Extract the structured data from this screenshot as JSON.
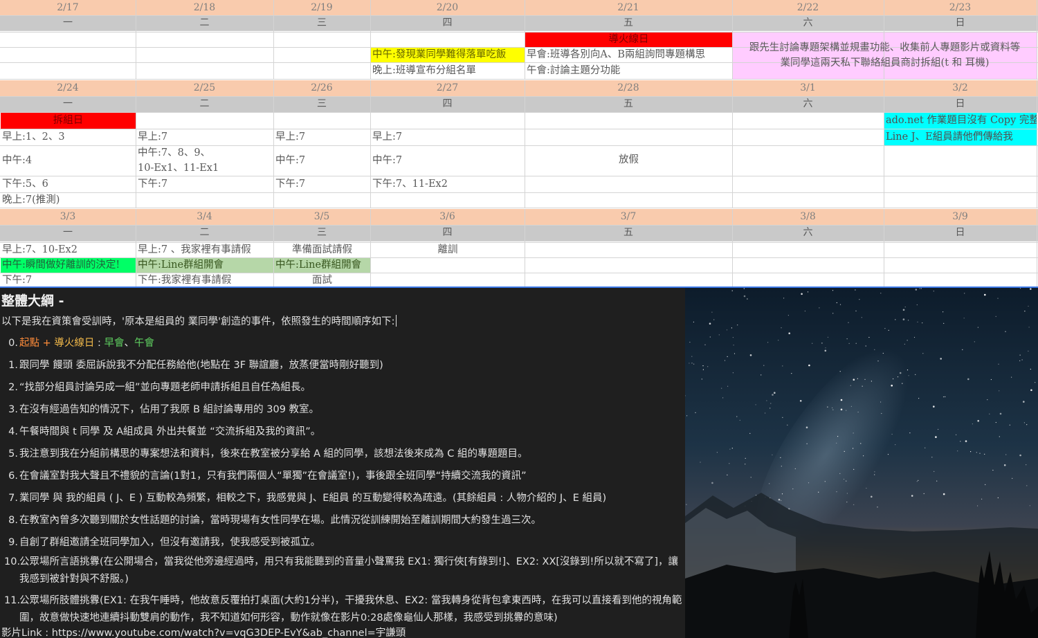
{
  "calendar": {
    "weeks": [
      {
        "dates": [
          "2/17",
          "2/18",
          "2/19",
          "2/20",
          "2/21",
          "2/22",
          "2/23"
        ],
        "weekdays": [
          "一",
          "二",
          "三",
          "四",
          "五",
          "六",
          "日"
        ],
        "cells": [
          {
            "text": "導火線日",
            "col": 4,
            "row": 0,
            "fill": "#ff0000",
            "color": "#7f0000",
            "align": "center"
          },
          {
            "text": "中午:發現業同學難得落單吃飯",
            "col": 3,
            "row": 1,
            "fill": "#ffff00",
            "color": "#666600"
          },
          {
            "text": "晚上:班導宣布分組名單",
            "col": 3,
            "row": 2
          },
          {
            "text": "早會:班導各別向A、B兩組詢問專題構思",
            "col": 4,
            "row": 1
          },
          {
            "text": "午會:討論主題分功能",
            "col": 4,
            "row": 2
          },
          {
            "text": "跟先生討論專題架構並規畫功能、收集前人專題影片或資料等",
            "col": 5,
            "row": 1,
            "span": 2,
            "align": "center"
          },
          {
            "text": "業同學這兩天私下聯絡組員商討拆組(t 和 耳機)",
            "col": 5,
            "row": 2,
            "span": 2,
            "align": "center"
          }
        ]
      },
      {
        "dates": [
          "2/24",
          "2/25",
          "2/26",
          "2/27",
          "2/28",
          "3/1",
          "3/2"
        ],
        "weekdays": [
          "一",
          "二",
          "三",
          "四",
          "五",
          "六",
          "日"
        ],
        "cells": [
          {
            "text": "拆組日",
            "col": 0,
            "row": 0,
            "fill": "#ff0000",
            "color": "#7f0000",
            "align": "center"
          },
          {
            "text": "早上:1、2、3",
            "col": 0,
            "row": 1
          },
          {
            "text": "中午:4",
            "col": 0,
            "row": 2
          },
          {
            "text": "下午:5、6",
            "col": 0,
            "row": 3
          },
          {
            "text": "晚上:7(推測)",
            "col": 0,
            "row": 4
          },
          {
            "text": "早上:7",
            "col": 1,
            "row": 1
          },
          {
            "text": "中午:7、8、9、",
            "col": 1,
            "row": 2
          },
          {
            "text": "10-Ex1、11-Ex1",
            "col": 1,
            "row": 2.9
          },
          {
            "text": "下午:7",
            "col": 1,
            "row": 3
          },
          {
            "text": "早上:7",
            "col": 2,
            "row": 1
          },
          {
            "text": "中午:7",
            "col": 2,
            "row": 2
          },
          {
            "text": "下午:7",
            "col": 2,
            "row": 3
          },
          {
            "text": "早上:7",
            "col": 3,
            "row": 1
          },
          {
            "text": "中午:7",
            "col": 3,
            "row": 2
          },
          {
            "text": "下午:7、11-Ex2",
            "col": 3,
            "row": 3
          },
          {
            "text": "放假",
            "col": 4,
            "row": 2,
            "align": "center"
          },
          {
            "text": "ado.net 作業題目沒有 Copy 完整",
            "col": 6,
            "row": 0,
            "fill": "#00ffff",
            "color": "#505050"
          },
          {
            "text": "Line J、E組員請他們傳給我",
            "col": 6,
            "row": 1,
            "fill": "#00ffff",
            "color": "#505050"
          }
        ]
      },
      {
        "dates": [
          "3/3",
          "3/4",
          "3/5",
          "3/6",
          "3/7",
          "3/8",
          "3/9"
        ],
        "weekdays": [
          "一",
          "二",
          "三",
          "四",
          "五",
          "六",
          "日"
        ],
        "cells": [
          {
            "text": "早上:7、10-Ex2",
            "col": 0,
            "row": 0
          },
          {
            "text": "中午:瞬間做好離訓的決定!",
            "col": 0,
            "row": 1,
            "fill": "#00ff66",
            "color": "#1f5f3a"
          },
          {
            "text": "下午:7",
            "col": 0,
            "row": 2
          },
          {
            "text": "早上:7 、我家裡有事請假",
            "col": 1,
            "row": 0
          },
          {
            "text": "中午:Line群組開會",
            "col": 1,
            "row": 1,
            "fill": "#b6d7a8",
            "color": "#38571f"
          },
          {
            "text": "下午:我家裡有事請假",
            "col": 1,
            "row": 2
          },
          {
            "text": "準備面試請假",
            "col": 2,
            "row": 0,
            "align": "center"
          },
          {
            "text": "中午:Line群組開會",
            "col": 2,
            "row": 1,
            "fill": "#b6d7a8",
            "color": "#38571f"
          },
          {
            "text": "面試",
            "col": 2,
            "row": 2,
            "align": "center"
          },
          {
            "text": "離訓",
            "col": 3,
            "row": 0,
            "align": "center"
          }
        ]
      }
    ]
  },
  "notes": {
    "title": "整體大綱 -",
    "intro": "以下是我在資策會受訓時，'原本是組員的 業同學'創造的事件，依照發生的時間順序如下:",
    "item0": {
      "num": "0.",
      "parts": [
        {
          "text": "起點",
          "color": "#ff8c3a"
        },
        {
          "text": " + ",
          "color": "#ff8c3a"
        },
        {
          "text": "導火線日",
          "color": "#f2b94a"
        },
        {
          "text": " : ",
          "color": "#e0e0e0"
        },
        {
          "text": "早會",
          "color": "#5fcf60"
        },
        {
          "text": "、",
          "color": "#e0e0e0"
        },
        {
          "text": "午會",
          "color": "#5fcf60"
        }
      ]
    },
    "items": [
      {
        "num": "1.",
        "text": "跟同學 饅頭 委屈訴說我不分配任務給他(地點在 3F 聯誼廳，放蒸便當時剛好聽到)"
      },
      {
        "num": "2.",
        "text": "“找部分組員討論另成一組”並向專題老師申請拆組且自任為組長。"
      },
      {
        "num": "3.",
        "text": "在沒有經過告知的情況下，佔用了我原 B 組討論專用的 309 教室。"
      },
      {
        "num": "4.",
        "text": "午餐時間與 t 同學 及 A組成員 外出共餐並 “交流拆組及我的資訊”。"
      },
      {
        "num": "5.",
        "text": "我注意到我在分組前構思的專案想法和資料，後來在教室被分享給 A 組的同學，該想法後來成為 C 組的專題題目。"
      },
      {
        "num": "6.",
        "text": "在會議室對我大聲且不禮貌的言論(1對1，只有我們兩個人“單獨”在會議室!)，事後跟全班同學“持續交流我的資訊”"
      },
      {
        "num": "7.",
        "text": "業同學 與 我的組員 ( J、E ) 互動較為頻繁，相較之下，我感覺與 J、E組員 的互動變得較為疏遠。(其餘組員 : 人物介紹的 J、E 組員)"
      },
      {
        "num": "8.",
        "text": "在教室內曾多次聽到關於女性話題的討論，當時現場有女性同學在場。此情況從訓練開始至離訓期間大約發生過三次。"
      },
      {
        "num": "9.",
        "text": "自創了群組邀請全班同學加入，但沒有邀請我，使我感受到被孤立。"
      },
      {
        "num": "10.",
        "text": "公眾場所言語挑釁(在公開場合，當我從他旁邊經過時，用只有我能聽到的音量小聲罵我 EX1: 獨行俠[有錄到!]、EX2: XX[沒錄到!所以就不寫了]，讓我感到被針對與不舒服。)"
      },
      {
        "num": "11.",
        "text": "公眾場所肢體挑釁(EX1: 在我午睡時，他故意反覆拍打桌面(大約1分半)，干擾我休息、EX2: 當我轉身從背包拿東西時，在我可以直接看到他的視角範圍，故意做快速地連續抖動雙肩的動作，我不知道如何形容，動作就像在影片0:28處像龜仙人那樣，我感受到挑釁的意味)"
      }
    ],
    "video_line": "影片Link : https://www.youtube.com/watch?v=vqG3DEP-EvY&ab_channel=宇謙頭"
  },
  "colors": {
    "header_date_bg": "#f9cbad",
    "header_weekday_bg": "#c9c9c9",
    "pink_cell_bg": "#ffccff",
    "notes_bg": "#1f1f1f"
  }
}
